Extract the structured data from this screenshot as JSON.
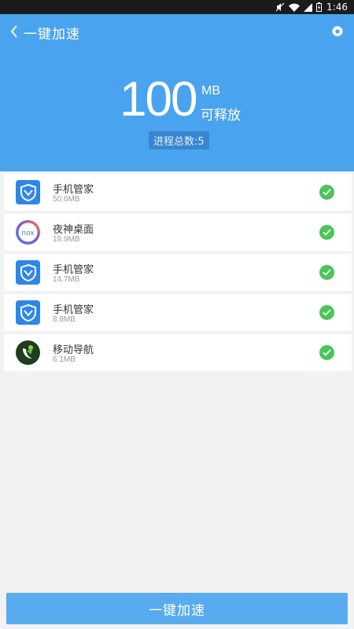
{
  "status_bar": {
    "time": "1:46"
  },
  "header": {
    "title": "一键加速",
    "amount": "100",
    "unit": "MB",
    "unit_label": "可释放",
    "process_count": "进程总数:5"
  },
  "apps": [
    {
      "name": "手机管家",
      "size": "50.6MB",
      "icon": "tencent-shield-icon",
      "checked": true
    },
    {
      "name": "夜神桌面",
      "size": "19.9MB",
      "icon": "nox-icon",
      "checked": true
    },
    {
      "name": "手机管家",
      "size": "14.7MB",
      "icon": "tencent-shield-icon",
      "checked": true
    },
    {
      "name": "手机管家",
      "size": "8.8MB",
      "icon": "tencent-shield-icon",
      "checked": true
    },
    {
      "name": "移动导航",
      "size": "6.1MB",
      "icon": "navigation-icon",
      "checked": true
    }
  ],
  "bottom_button": {
    "label": "一键加速"
  },
  "colors": {
    "accent": "#4aa3ee",
    "check": "#4cc45a",
    "button": "#58abef"
  }
}
